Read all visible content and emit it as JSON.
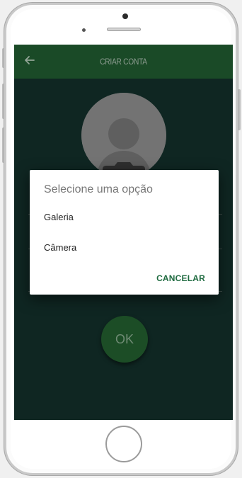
{
  "app_bar": {
    "title": "CRIAR CONTA",
    "back_icon": "arrow-left-icon"
  },
  "avatar": {
    "icon": "camera-icon"
  },
  "ok_button": {
    "label": "OK"
  },
  "dialog": {
    "title": "Selecione uma opção",
    "options": [
      {
        "label": "Galeria"
      },
      {
        "label": "Câmera"
      }
    ],
    "cancel_label": "CANCELAR"
  },
  "colors": {
    "app_bar": "#1a4a27",
    "screen_bg": "#0f2622",
    "ok_button": "#1c4d26",
    "cancel_text": "#1f6b40"
  }
}
